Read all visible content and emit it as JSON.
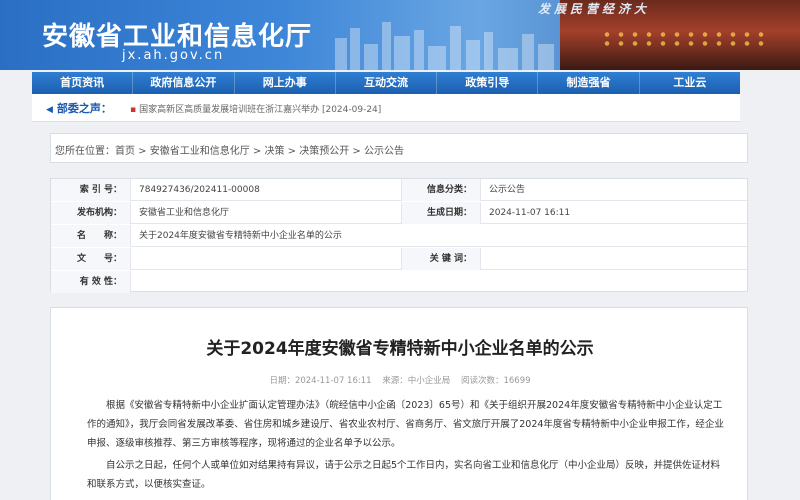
{
  "header": {
    "site_title": "安徽省工业和信息化厅",
    "site_url": "jx.ah.gov.cn",
    "banner_caption": "发展民营经济大"
  },
  "nav": {
    "items": [
      "首页资讯",
      "政府信息公开",
      "网上办事",
      "互动交流",
      "政策引导",
      "制造强省",
      "工业云"
    ]
  },
  "sub_nav": {
    "label": "部委之声：",
    "news": "国家高新区高质量发展培训班在浙江嘉兴举办 [2024-09-24]"
  },
  "breadcrumb": {
    "prefix": "您所在位置：",
    "items": [
      "首页",
      "安徽省工业和信息化厅",
      "决策",
      "决策预公开",
      "公示公告"
    ]
  },
  "info": {
    "index_label": "索 引 号：",
    "index_value": "784927436/202411-00008",
    "category_label": "信息分类：",
    "category_value": "公示公告",
    "publisher_label": "发布机构：",
    "publisher_value": "安徽省工业和信息化厅",
    "date_label": "生成日期：",
    "date_value": "2024-11-07 16:11",
    "name_label": "名　　称：",
    "name_value": "关于2024年度安徽省专精特新中小企业名单的公示",
    "doc_label": "文　　号：",
    "doc_value": "",
    "keyword_label": "关 键 词：",
    "keyword_value": "",
    "valid_label": "有 效 性：",
    "valid_value": ""
  },
  "article": {
    "title": "关于2024年度安徽省专精特新中小企业名单的公示",
    "meta_date": "日期：2024-11-07 16:11",
    "meta_source": "来源：中小企业局",
    "meta_views": "阅读次数：16699",
    "para1": "根据《安徽省专精特新中小企业扩面认定管理办法》（皖经信中小企函〔2023〕65号）和《关于组织开展2024年度安徽省专精特新中小企业认定工作的通知》，我厅会同省发展改革委、省住房和城乡建设厅、省农业农村厅、省商务厅、省文旅厅开展了2024年度省专精特新中小企业申报工作，经企业申报、逐级审核推荐、第三方审核等程序，现将通过的企业名单予以公示。",
    "para2": "自公示之日起，任何个人或单位如对结果持有异议，请于公示之日起5个工作日内，实名向省工业和信息化厅（中小企业局）反映，并提供佐证材料和联系方式，以便核实查证。"
  }
}
